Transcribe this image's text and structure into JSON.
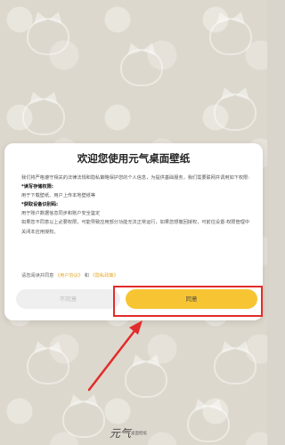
{
  "dialog": {
    "title": "欢迎您使用元气桌面壁纸",
    "intro": "我们将严格遵守相关的法律法规和隐私策略保护您的个人信息，为提供基础服务，我们需要联网并调用如下权限:",
    "permissions": [
      {
        "heading": "*读写存储权限:",
        "text": "用于下载壁纸、用户上传本地壁纸等"
      },
      {
        "heading": "*获取设备识别码:",
        "text": "用于账户数据信息同步和账户安全鉴定"
      }
    ],
    "notice": "如果您不同意以上必要权限，可能导致应用部分功能无法正常运行，如果您想撤回授权，可前往设置-权限管理中关闭本应用授权。",
    "consent": {
      "prefix": "请您阅读并同意",
      "user_agreement": "《用户协议》",
      "and": "和",
      "privacy_policy": "《隐私政策》"
    },
    "buttons": {
      "decline": "不同意",
      "agree": "同意"
    }
  },
  "branding": {
    "logo_text": "元气",
    "logo_sub": "桌面壁纸"
  },
  "colors": {
    "accent": "#f7c533",
    "link": "#e2a928",
    "annotation": "#e32b2b"
  }
}
